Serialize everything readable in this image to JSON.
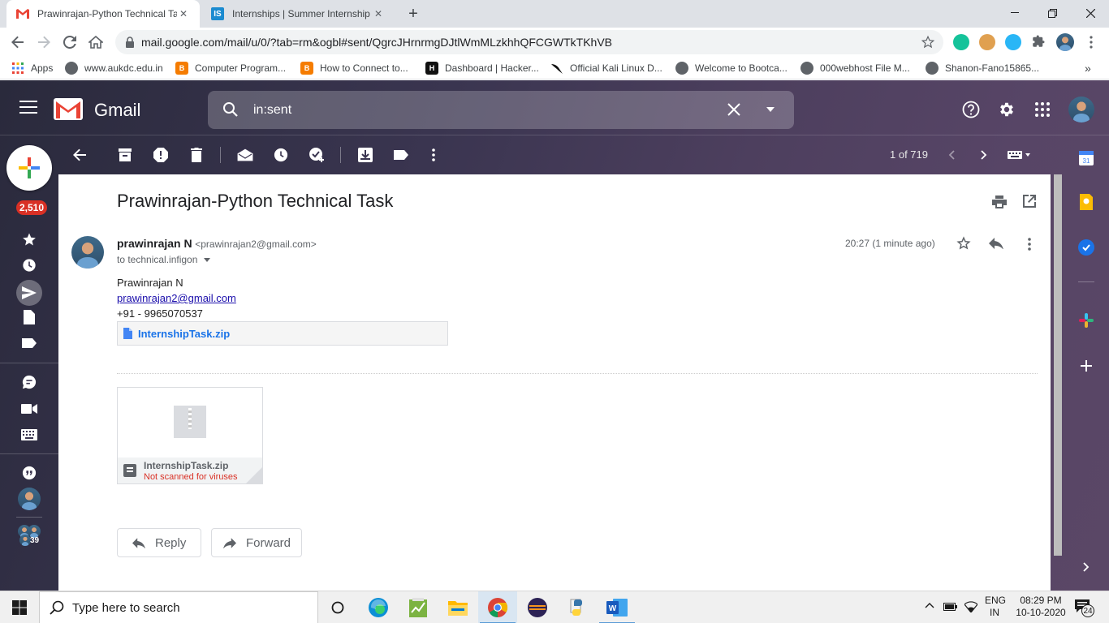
{
  "browser": {
    "tabs": [
      {
        "title": "Prawinrajan-Python Technical Tas",
        "favicon": "gmail-icon",
        "active": true
      },
      {
        "title": "Internships | Summer Internship",
        "favicon": "internshala-icon",
        "favicon_text": "IS",
        "active": false
      }
    ],
    "new_tab_label": "+",
    "url": "mail.google.com/mail/u/0/?tab=rm&ogbl#sent/QgrcJHrnrmgDJtlWmMLzkhhQFCGWTkTKhVB"
  },
  "bookmarks": [
    {
      "label": "Apps",
      "icon": "apps-grid-icon"
    },
    {
      "label": "www.aukdc.edu.in",
      "icon": "globe-icon"
    },
    {
      "label": "Computer Program...",
      "icon": "blogger-icon"
    },
    {
      "label": "How to Connect to...",
      "icon": "blogger-icon"
    },
    {
      "label": "Dashboard | Hacker...",
      "icon": "hackerrank-icon",
      "icon_text": "H"
    },
    {
      "label": "Official Kali Linux D...",
      "icon": "kali-icon"
    },
    {
      "label": "Welcome to Bootca...",
      "icon": "globe-icon"
    },
    {
      "label": "000webhost File M...",
      "icon": "globe-icon"
    },
    {
      "label": "Shanon-Fano15865...",
      "icon": "globe-icon"
    }
  ],
  "gmail": {
    "logo_text": "Gmail",
    "search_query": "in:sent",
    "unread_count": "2,510",
    "pagination": "1 of 719",
    "people_badge": "39",
    "email": {
      "subject": "Prawinrajan-Python Technical Task",
      "sender_name": "prawinrajan N",
      "sender_email": "<prawinrajan2@gmail.com>",
      "recipient": "to technical.infigon",
      "time": "20:27 (1 minute ago)",
      "body": {
        "line1": "Prawinrajan N",
        "email_link": "prawinrajan2@gmail.com",
        "phone": "+91 - 9965070537"
      },
      "inline_attachment": "InternshipTask.zip",
      "attachment": {
        "filename": "InternshipTask.zip",
        "status": "Not scanned for viruses"
      },
      "reply_label": "Reply",
      "forward_label": "Forward"
    }
  },
  "taskbar": {
    "search_placeholder": "Type here to search",
    "lang_top": "ENG",
    "lang_bottom": "IN",
    "time": "08:29 PM",
    "date": "10-10-2020",
    "notification_count": "24"
  },
  "colors": {
    "gmail_red": "#ea4335",
    "link_blue": "#1a0dab",
    "attachment_blue": "#1a73e8",
    "virus_warning": "#d93025"
  }
}
